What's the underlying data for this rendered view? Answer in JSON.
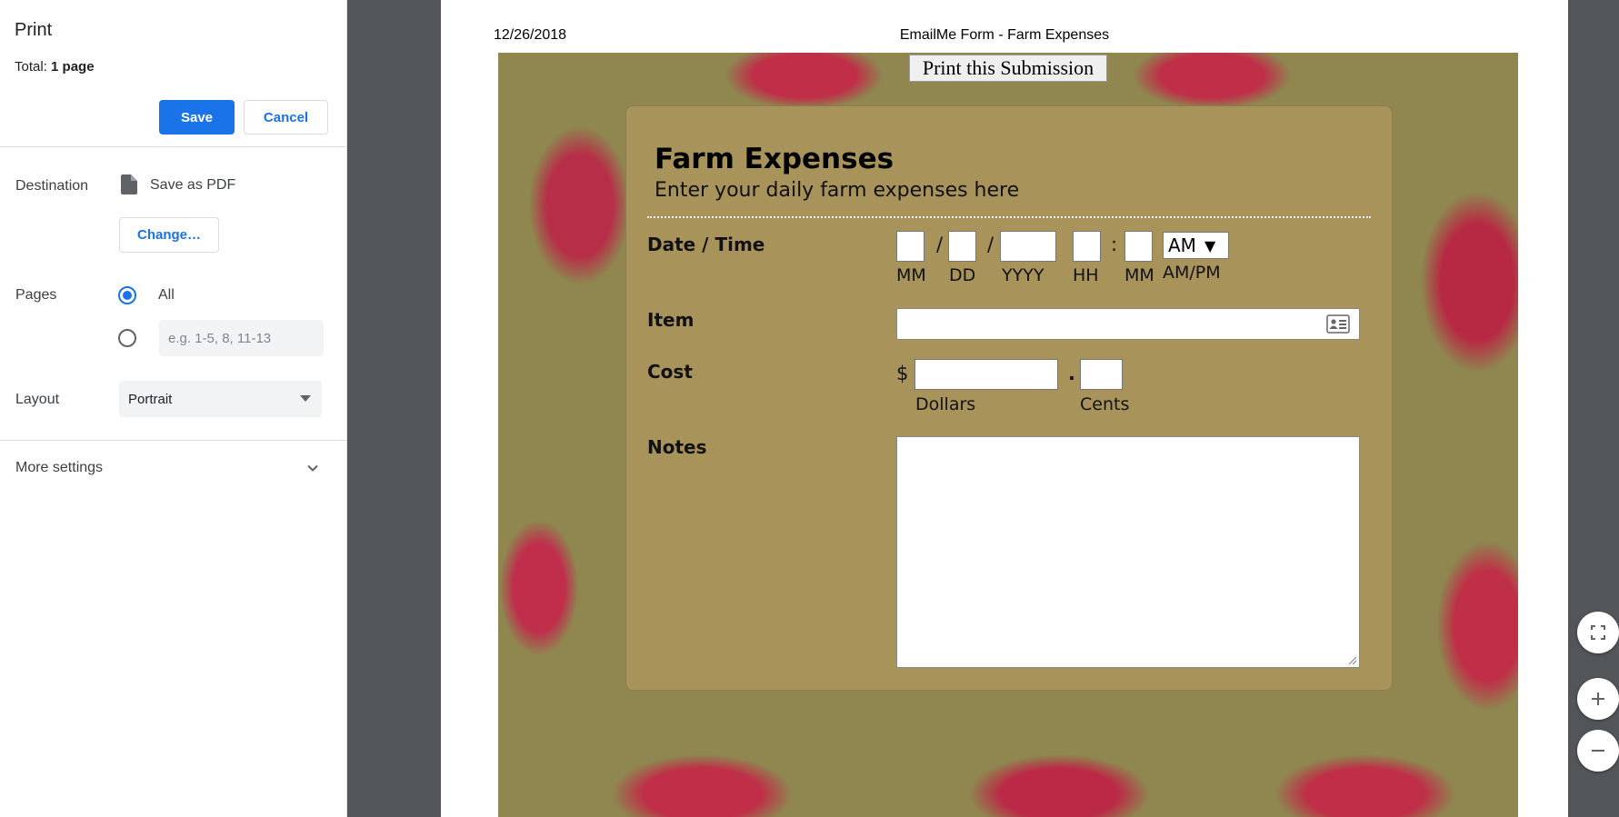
{
  "panel": {
    "title": "Print",
    "total_label": "Total:",
    "total_value": "1 page",
    "save_label": "Save",
    "cancel_label": "Cancel",
    "destination_label": "Destination",
    "destination_value": "Save as PDF",
    "change_label": "Change…",
    "pages_label": "Pages",
    "pages_all_label": "All",
    "pages_custom_placeholder": "e.g. 1-5, 8, 11-13",
    "layout_label": "Layout",
    "layout_value": "Portrait",
    "more_settings_label": "More settings"
  },
  "preview": {
    "header_date": "12/26/2018",
    "header_title": "EmailMe Form - Farm Expenses",
    "print_submission_label": "Print this Submission",
    "form": {
      "title": "Farm Expenses",
      "subtitle": "Enter your daily farm expenses here",
      "date_time_label": "Date / Time",
      "date_sep": "/",
      "time_sep": ":",
      "mm_label": "MM",
      "dd_label": "DD",
      "yyyy_label": "YYYY",
      "hh_label": "HH",
      "min_label": "MM",
      "ampm_value": "AM",
      "ampm_label": "AM/PM",
      "item_label": "Item",
      "cost_label": "Cost",
      "currency_symbol": "$",
      "decimal_point": ".",
      "dollars_label": "Dollars",
      "cents_label": "Cents",
      "notes_label": "Notes"
    }
  },
  "colors": {
    "accent": "#1a73e8",
    "preview_bg": "#525659",
    "card_bg": "#a8935a",
    "pattern_red": "#c81e46"
  }
}
